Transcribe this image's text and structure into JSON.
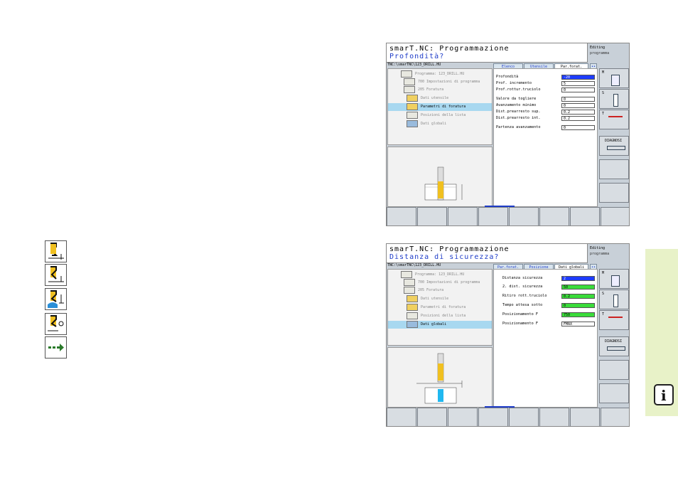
{
  "screen1": {
    "title": "smarT.NC: Programmazione",
    "subtitle": "Profondità?",
    "mode_label": "Editing",
    "mode_value": "programma",
    "path": "TNC:\\smarTNC\\123_DRILL.HU",
    "tabs": [
      "Elenco",
      "Utensile",
      "Par.forat."
    ],
    "tabs_more": "••",
    "tree": [
      "Programma: 123_DRILL.HU",
      "700 Impostazioni di programma",
      "205 Foratura",
      "Dati utensile",
      "Parametri di foratura",
      "Posizioni della lista",
      "Dati globali"
    ],
    "fields": [
      {
        "label": "Profondità",
        "value": "-20"
      },
      {
        "label": "Prof. incremento",
        "value": "5"
      },
      {
        "label": "Prof.rottur.truciolo",
        "value": "0"
      },
      {
        "label": "Valore da togliere",
        "value": "0"
      },
      {
        "label": "Avanzamento minimo",
        "value": "0"
      },
      {
        "label": "Dist.prearresto sup.",
        "value": "0.2"
      },
      {
        "label": "Dist.prearresto int.",
        "value": "0.2"
      },
      {
        "label": "Partenza avanzamento",
        "value": "0"
      }
    ],
    "softkeys": [
      "M",
      "S",
      "T",
      "DIAGNOSI"
    ]
  },
  "screen2": {
    "title": "smarT.NC: Programmazione",
    "subtitle": "Distanza di sicurezza?",
    "mode_label": "Editing",
    "mode_value": "programma",
    "path": "TNC:\\smarTNC\\123_DRILL.HU",
    "tabs": [
      "Par.forat.",
      "Posizione",
      "Dati globali"
    ],
    "tabs_more": "••",
    "tree": [
      "Programma: 123_DRILL.HU",
      "700 Impostazioni di programma",
      "205 Foratura",
      "Dati utensile",
      "Parametri di foratura",
      "Posizioni della lista",
      "Dati globali"
    ],
    "fields": [
      {
        "label": "Distanza sicurezza",
        "value": "2"
      },
      {
        "label": "2. dist. sicurezza",
        "value": "50"
      },
      {
        "label": "Ritiro rott.truciolo",
        "value": "0.2"
      },
      {
        "label": "Tempo attesa sotto",
        "value": "0"
      },
      {
        "label": "Posizionamento F",
        "value": "750"
      },
      {
        "label": "Posizionamento F",
        "value": "FMAX"
      }
    ],
    "softkeys": [
      "M",
      "S",
      "T",
      "DIAGNOSI"
    ]
  },
  "icons": [
    "drill-depth-icon",
    "drill-depth-alt-icon",
    "drill-safety-icon",
    "drill-chip-icon",
    "arrow-right-icon"
  ],
  "info_icon": "i",
  "colors": {
    "accent_blue": "#1e3cc8",
    "field_green": "#3adc3a",
    "selection": "#a8d8f0",
    "sidebar": "#e8f2c8"
  }
}
